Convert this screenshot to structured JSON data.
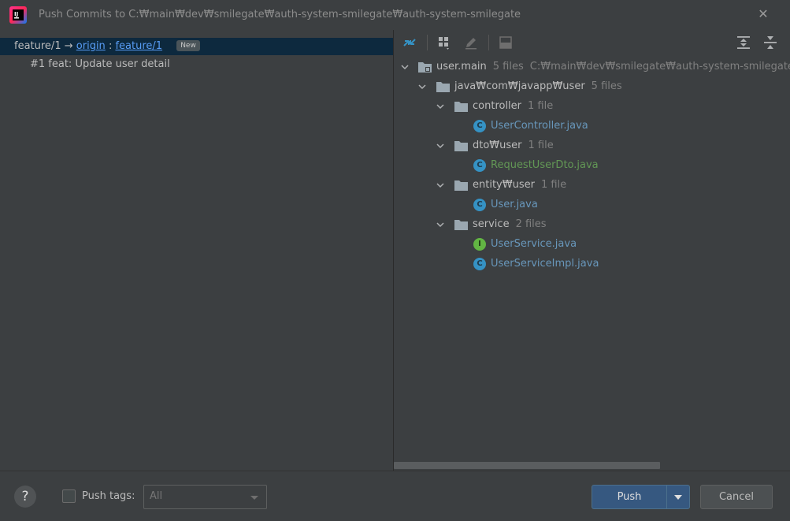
{
  "window": {
    "title": "Push Commits to C:₩main₩dev₩smilegate₩auth-system-smilegate₩auth-system-smilegate",
    "close_icon": "close-icon"
  },
  "commits_panel": {
    "local_branch": "feature/1",
    "arrow": "→",
    "remote": "origin",
    "separator": ":",
    "remote_branch": "feature/1",
    "badge": "New",
    "commit": "#1 feat: Update user detail"
  },
  "files_panel": {
    "toolbar": [
      "show-diff-icon",
      "group-by-icon",
      "edit-source-icon",
      "preview-diff-icon",
      "expand-all-icon",
      "collapse-all-icon"
    ],
    "tree": {
      "root": {
        "name": "user.main",
        "count": "5 files",
        "path": "C:₩main₩dev₩smilegate₩auth-system-smilegate₩au"
      },
      "package": {
        "name": "java₩com₩javapp₩user",
        "count": "5 files"
      },
      "folders": [
        {
          "name": "controller",
          "count": "1 file",
          "files": [
            {
              "name": "UserController.java",
              "kind": "C",
              "status": "modified"
            }
          ]
        },
        {
          "name": "dto₩user",
          "count": "1 file",
          "files": [
            {
              "name": "RequestUserDto.java",
              "kind": "C",
              "status": "added"
            }
          ]
        },
        {
          "name": "entity₩user",
          "count": "1 file",
          "files": [
            {
              "name": "User.java",
              "kind": "C",
              "status": "modified"
            }
          ]
        },
        {
          "name": "service",
          "count": "2 files",
          "files": [
            {
              "name": "UserService.java",
              "kind": "I",
              "status": "modified"
            },
            {
              "name": "UserServiceImpl.java",
              "kind": "C",
              "status": "modified"
            }
          ]
        }
      ]
    },
    "colors": {
      "modified": "#6897bb",
      "added": "#629755"
    }
  },
  "footer": {
    "help": "?",
    "push_tags_label": "Push tags:",
    "push_tags_checked": false,
    "tags_select_value": "All",
    "push_label": "Push",
    "cancel_label": "Cancel"
  }
}
